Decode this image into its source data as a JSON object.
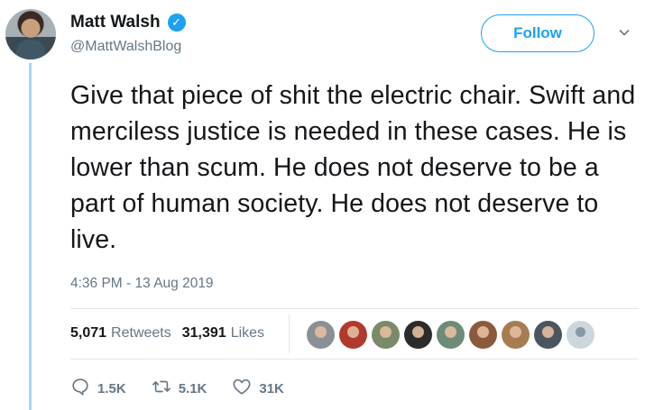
{
  "author": {
    "display_name": "Matt Walsh",
    "handle": "@MattWalshBlog",
    "verified_glyph": "✓"
  },
  "follow_label": "Follow",
  "tweet": {
    "text": "Give that piece of shit the electric chair. Swift and merciless justice is needed in these cases. He is lower than scum. He does not deserve to be a part of human society. He does not deserve to live.",
    "timestamp": "4:36 PM - 13 Aug 2019"
  },
  "stats": {
    "retweets_count": "5,071",
    "retweets_label": "Retweets",
    "likes_count": "31,391",
    "likes_label": "Likes"
  },
  "actions": {
    "reply_count": "1.5K",
    "retweet_count": "5.1K",
    "like_count": "31K"
  },
  "colors": {
    "accent": "#1da1f2",
    "muted": "#657786",
    "thread_line": "#9fd6f5"
  },
  "icons": [
    "verified-badge-icon",
    "chevron-down-icon",
    "reply-icon",
    "retweet-icon",
    "heart-icon"
  ]
}
